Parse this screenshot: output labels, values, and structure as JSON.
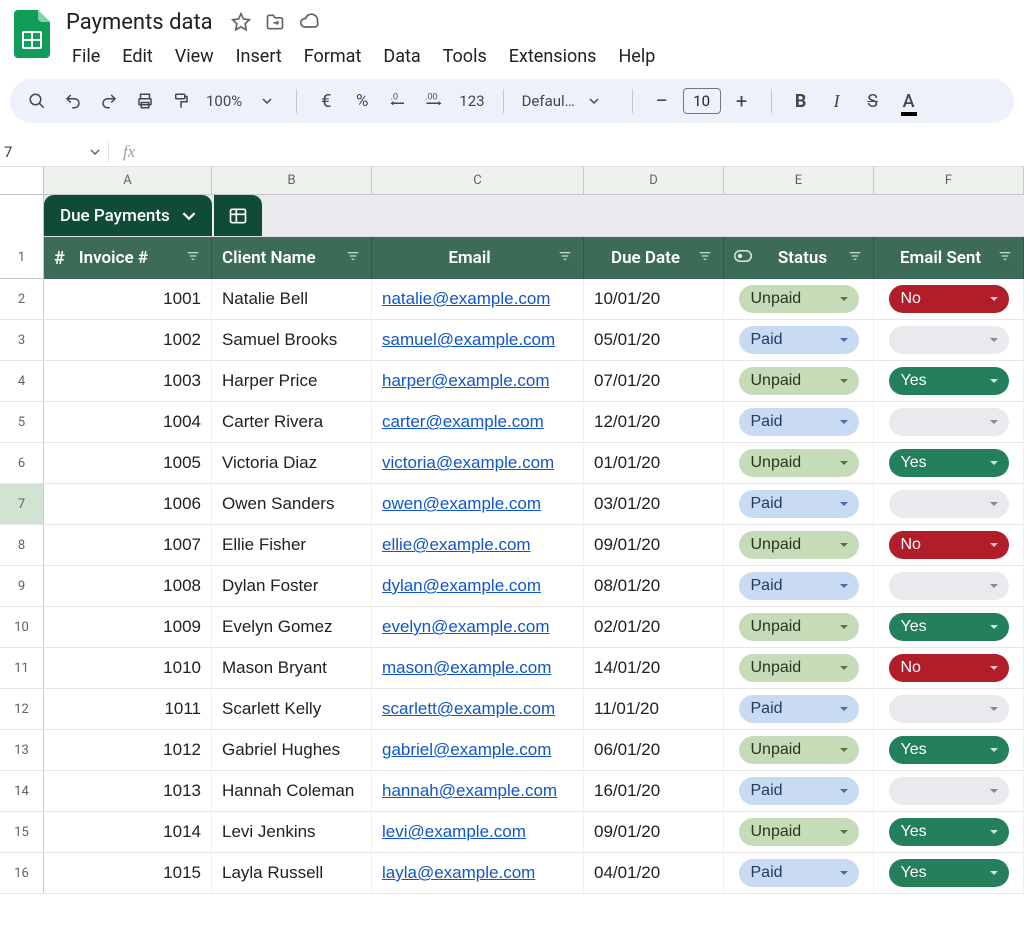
{
  "doc": {
    "title": "Payments data"
  },
  "menus": [
    "File",
    "Edit",
    "View",
    "Insert",
    "Format",
    "Data",
    "Tools",
    "Extensions",
    "Help"
  ],
  "toolbar": {
    "zoom": "100%",
    "font_name": "Defaul…",
    "font_size": "10",
    "decimal_text": "123"
  },
  "namebox": {
    "value": "7"
  },
  "col_letters": [
    "A",
    "B",
    "C",
    "D",
    "E",
    "F"
  ],
  "col_widths": [
    "colA",
    "colB",
    "colC",
    "colD",
    "colE",
    "colF"
  ],
  "tab": {
    "label": "Due Payments"
  },
  "headers": {
    "hash": "#",
    "invoice": "Invoice #",
    "client": "Client Name",
    "email": "Email",
    "due": "Due Date",
    "status": "Status",
    "sent": "Email Sent"
  },
  "selected_row_number": 7,
  "rows": [
    {
      "n": 2,
      "invoice": "1001",
      "client": "Natalie Bell",
      "email": "natalie@example.com",
      "due": "10/01/20",
      "status": "Unpaid",
      "sent": "No"
    },
    {
      "n": 3,
      "invoice": "1002",
      "client": "Samuel Brooks",
      "email": "samuel@example.com",
      "due": "05/01/20",
      "status": "Paid",
      "sent": ""
    },
    {
      "n": 4,
      "invoice": "1003",
      "client": "Harper Price",
      "email": "harper@example.com",
      "due": "07/01/20",
      "status": "Unpaid",
      "sent": "Yes"
    },
    {
      "n": 5,
      "invoice": "1004",
      "client": "Carter Rivera",
      "email": "carter@example.com",
      "due": "12/01/20",
      "status": "Paid",
      "sent": ""
    },
    {
      "n": 6,
      "invoice": "1005",
      "client": "Victoria Diaz",
      "email": "victoria@example.com",
      "due": "01/01/20",
      "status": "Unpaid",
      "sent": "Yes"
    },
    {
      "n": 7,
      "invoice": "1006",
      "client": "Owen Sanders",
      "email": "owen@example.com",
      "due": "03/01/20",
      "status": "Paid",
      "sent": ""
    },
    {
      "n": 8,
      "invoice": "1007",
      "client": "Ellie Fisher",
      "email": "ellie@example.com",
      "due": "09/01/20",
      "status": "Unpaid",
      "sent": "No"
    },
    {
      "n": 9,
      "invoice": "1008",
      "client": "Dylan Foster",
      "email": "dylan@example.com",
      "due": "08/01/20",
      "status": "Paid",
      "sent": ""
    },
    {
      "n": 10,
      "invoice": "1009",
      "client": "Evelyn Gomez",
      "email": "evelyn@example.com",
      "due": "02/01/20",
      "status": "Unpaid",
      "sent": "Yes"
    },
    {
      "n": 11,
      "invoice": "1010",
      "client": "Mason Bryant",
      "email": "mason@example.com",
      "due": "14/01/20",
      "status": "Unpaid",
      "sent": "No"
    },
    {
      "n": 12,
      "invoice": "1011",
      "client": "Scarlett Kelly",
      "email": "scarlett@example.com",
      "due": "11/01/20",
      "status": "Paid",
      "sent": ""
    },
    {
      "n": 13,
      "invoice": "1012",
      "client": "Gabriel Hughes",
      "email": "gabriel@example.com",
      "due": "06/01/20",
      "status": "Unpaid",
      "sent": "Yes"
    },
    {
      "n": 14,
      "invoice": "1013",
      "client": "Hannah Coleman",
      "email": "hannah@example.com",
      "due": "16/01/20",
      "status": "Paid",
      "sent": ""
    },
    {
      "n": 15,
      "invoice": "1014",
      "client": "Levi Jenkins",
      "email": "levi@example.com",
      "due": "09/01/20",
      "status": "Unpaid",
      "sent": "Yes"
    },
    {
      "n": 16,
      "invoice": "1015",
      "client": "Layla Russell",
      "email": "layla@example.com",
      "due": "04/01/20",
      "status": "Paid",
      "sent": "Yes"
    }
  ]
}
